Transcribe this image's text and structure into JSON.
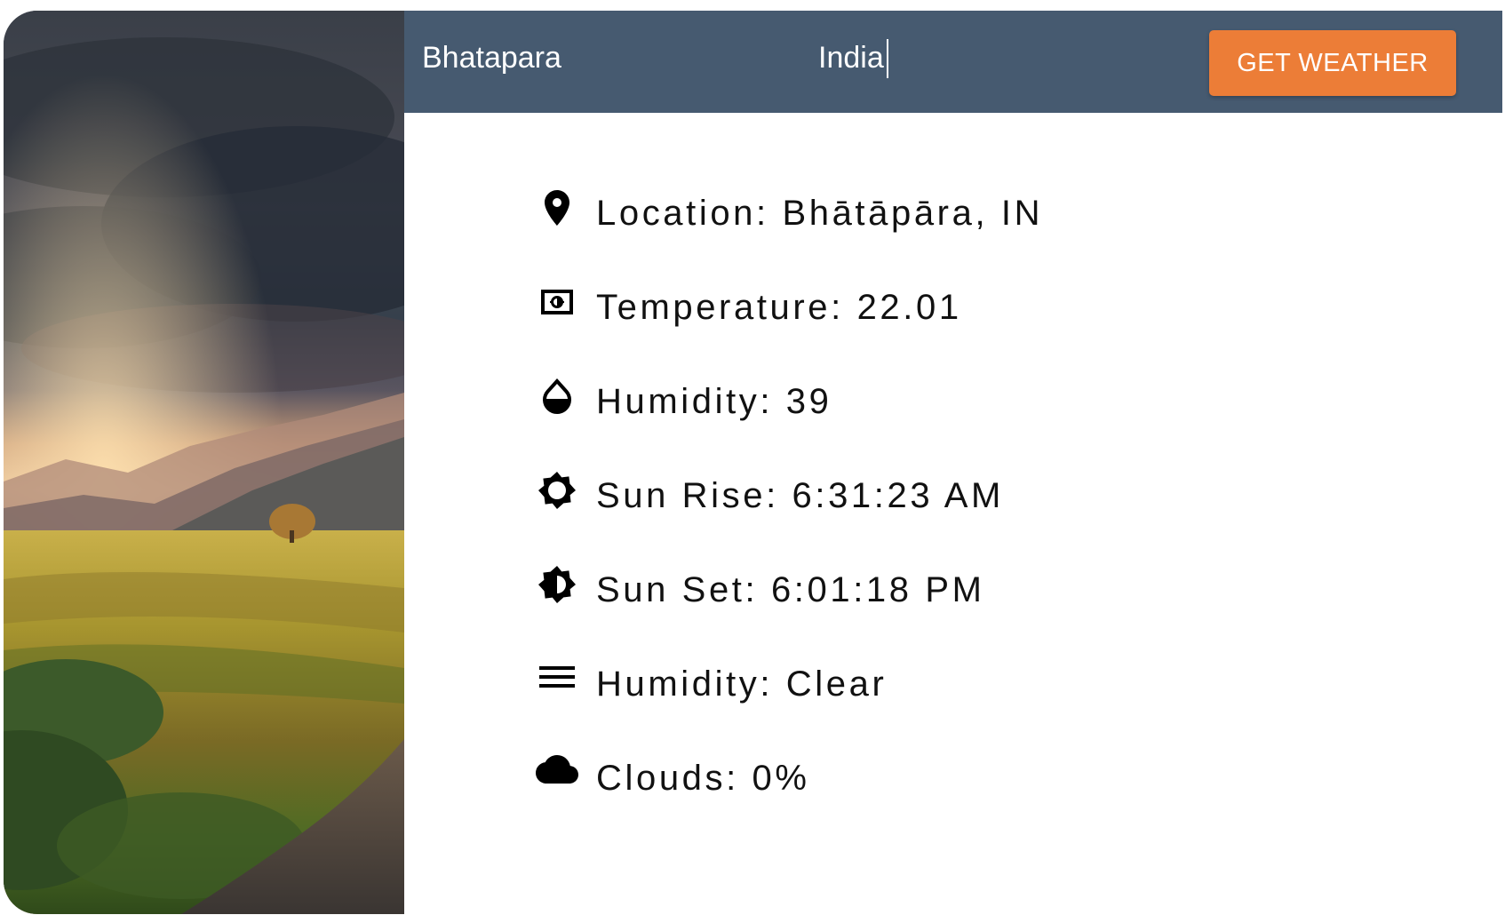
{
  "header": {
    "city_value": "Bhatapara",
    "country_value": "India",
    "button_label": "GET WEATHER"
  },
  "weather": {
    "location": "Location: Bhātāpāra, IN",
    "temperature": "Temperature: 22.01",
    "humidity": "Humidity: 39",
    "sunrise": "Sun Rise: 6:31:23 AM",
    "sunset": "Sun Set: 6:01:18 PM",
    "condition": "Humidity: Clear",
    "clouds": "Clouds: 0%"
  },
  "icons": {
    "location": "map-pin-icon",
    "temperature": "thermostat-icon",
    "humidity": "water-drop-icon",
    "sunrise": "sunrise-icon",
    "sunset": "sunset-icon",
    "condition": "menu-lines-icon",
    "clouds": "cloud-icon"
  },
  "colors": {
    "header_bg": "#465a70",
    "button_bg": "#ec7d37",
    "text": "#111111"
  }
}
